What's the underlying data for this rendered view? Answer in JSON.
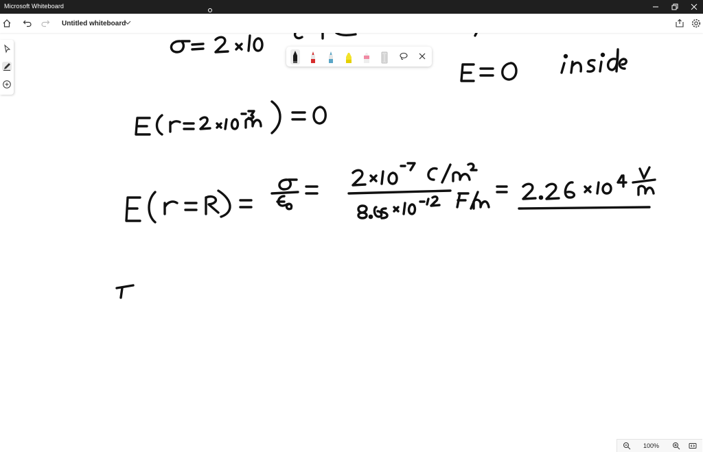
{
  "window": {
    "app_title": "Microsoft Whiteboard"
  },
  "toolbar": {
    "board_title": "Untitled whiteboard"
  },
  "pen_tray": {
    "pens": [
      {
        "name": "black-pen",
        "color": "#1a1a1a"
      },
      {
        "name": "red-pen",
        "color": "#d62d2d"
      },
      {
        "name": "blue-pen",
        "color": "#5aa6c7"
      },
      {
        "name": "yellow-highlighter",
        "color": "#f2e22b"
      },
      {
        "name": "pink-highlighter",
        "color": "#f08aa3"
      },
      {
        "name": "eraser",
        "color": "#cfcfcf"
      }
    ]
  },
  "zoom": {
    "level": "100%"
  },
  "colors": {
    "ink": "#111111",
    "titlebar": "#1f1f1f"
  }
}
